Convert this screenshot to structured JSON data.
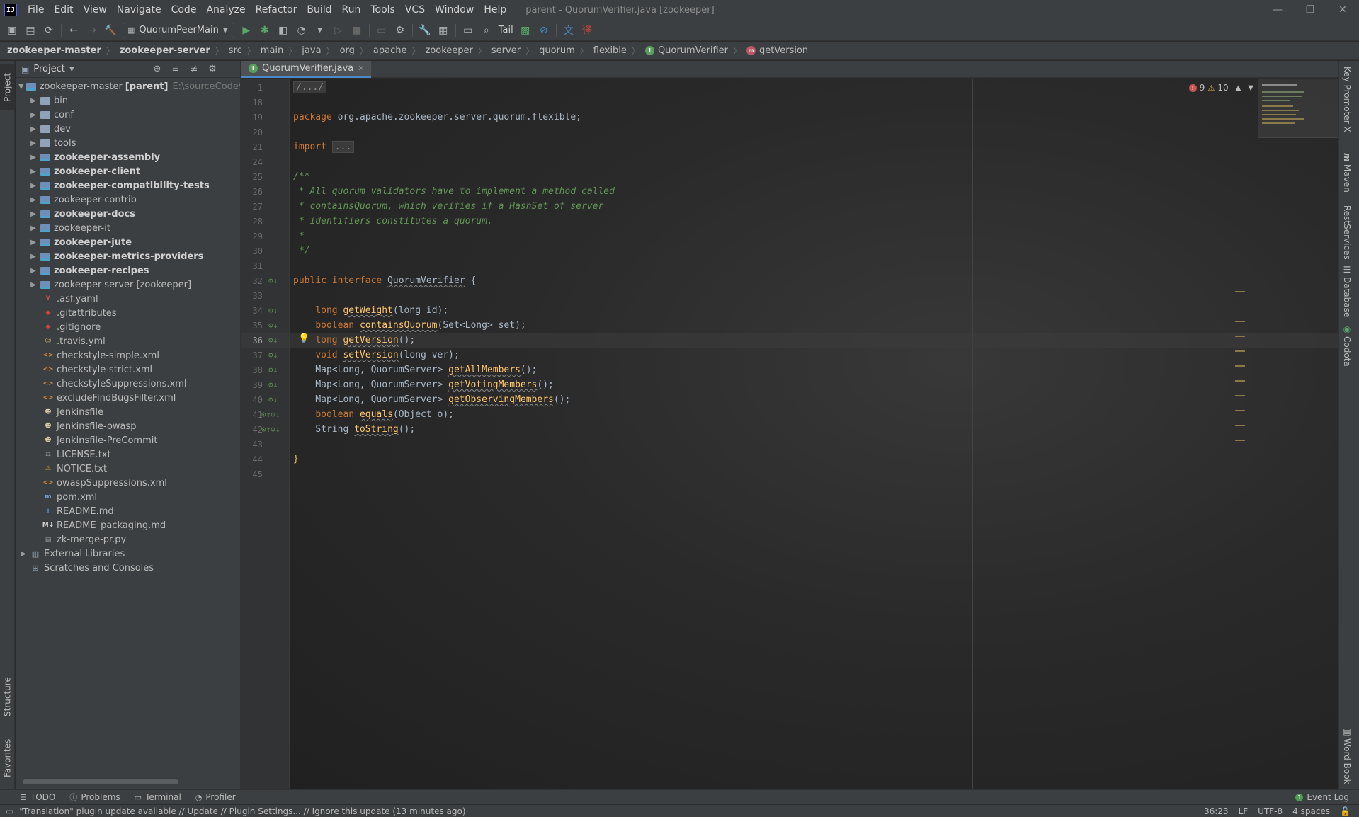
{
  "menu": {
    "items": [
      "File",
      "Edit",
      "View",
      "Navigate",
      "Code",
      "Analyze",
      "Refactor",
      "Build",
      "Run",
      "Tools",
      "VCS",
      "Window",
      "Help"
    ],
    "window_title": "parent - QuorumVerifier.java [zookeeper]"
  },
  "toolbar": {
    "run_config": "QuorumPeerMain",
    "tail_label": "Tail"
  },
  "breadcrumb": {
    "items": [
      "zookeeper-master",
      "zookeeper-server",
      "src",
      "main",
      "java",
      "org",
      "apache",
      "zookeeper",
      "server",
      "quorum",
      "flexible",
      "QuorumVerifier",
      "getVersion"
    ]
  },
  "side_tabs": {
    "project": "Project",
    "structure": "Structure",
    "favorites": "Favorites",
    "key_promoter": "Key Promoter X",
    "maven": "Maven",
    "rest_services": "RestServices",
    "database": "Database",
    "codota": "Codota",
    "word_book": "Word Book"
  },
  "project_panel": {
    "title": "Project",
    "root": {
      "name": "zookeeper-master",
      "suffix": "[parent]",
      "path": "E:\\sourceCode\\zo"
    },
    "items": [
      {
        "label": "bin",
        "kind": "folder",
        "bold": false
      },
      {
        "label": "conf",
        "kind": "folder",
        "bold": false
      },
      {
        "label": "dev",
        "kind": "folder",
        "bold": false
      },
      {
        "label": "tools",
        "kind": "folder",
        "bold": false
      },
      {
        "label": "zookeeper-assembly",
        "kind": "module",
        "bold": true
      },
      {
        "label": "zookeeper-client",
        "kind": "module",
        "bold": true
      },
      {
        "label": "zookeeper-compatibility-tests",
        "kind": "module",
        "bold": true
      },
      {
        "label": "zookeeper-contrib",
        "kind": "module",
        "bold": false
      },
      {
        "label": "zookeeper-docs",
        "kind": "module",
        "bold": true
      },
      {
        "label": "zookeeper-it",
        "kind": "module",
        "bold": false
      },
      {
        "label": "zookeeper-jute",
        "kind": "module",
        "bold": true
      },
      {
        "label": "zookeeper-metrics-providers",
        "kind": "module",
        "bold": true
      },
      {
        "label": "zookeeper-recipes",
        "kind": "module",
        "bold": true
      },
      {
        "label": "zookeeper-server [zookeeper]",
        "kind": "module",
        "bold": false
      }
    ],
    "files": [
      {
        "label": ".asf.yaml",
        "icon": "yaml-icon",
        "color": "#c75450",
        "glyph": "Y"
      },
      {
        "label": ".gitattributes",
        "icon": "git-icon",
        "color": "#d0463a",
        "glyph": "◆"
      },
      {
        "label": ".gitignore",
        "icon": "git-icon",
        "color": "#d0463a",
        "glyph": "◆"
      },
      {
        "label": ".travis.yml",
        "icon": "travis-icon",
        "color": "#c9a86a",
        "glyph": "☺"
      },
      {
        "label": "checkstyle-simple.xml",
        "icon": "xml-icon",
        "color": "#d08a3a",
        "glyph": "<>"
      },
      {
        "label": "checkstyle-strict.xml",
        "icon": "xml-icon",
        "color": "#d08a3a",
        "glyph": "<>"
      },
      {
        "label": "checkstyleSuppressions.xml",
        "icon": "xml-icon",
        "color": "#d08a3a",
        "glyph": "<>"
      },
      {
        "label": "excludeFindBugsFilter.xml",
        "icon": "xml-icon",
        "color": "#d08a3a",
        "glyph": "<>"
      },
      {
        "label": "Jenkinsfile",
        "icon": "jenkins-icon",
        "color": "#d8c9a8",
        "glyph": "☻"
      },
      {
        "label": "Jenkinsfile-owasp",
        "icon": "jenkins-icon",
        "color": "#d8c9a8",
        "glyph": "☻"
      },
      {
        "label": "Jenkinsfile-PreCommit",
        "icon": "jenkins-icon",
        "color": "#d8c9a8",
        "glyph": "☻"
      },
      {
        "label": "LICENSE.txt",
        "icon": "license-icon",
        "color": "#a0a0a0",
        "glyph": "⚖"
      },
      {
        "label": "NOTICE.txt",
        "icon": "warning-icon",
        "color": "#e0a030",
        "glyph": "⚠"
      },
      {
        "label": "owaspSuppressions.xml",
        "icon": "xml-icon",
        "color": "#d08a3a",
        "glyph": "<>"
      },
      {
        "label": "pom.xml",
        "icon": "maven-icon",
        "color": "#7aa0d8",
        "glyph": "m"
      },
      {
        "label": "README.md",
        "icon": "info-icon",
        "color": "#4a88c7",
        "glyph": "i"
      },
      {
        "label": "README_packaging.md",
        "icon": "markdown-icon",
        "color": "#d0d0d0",
        "glyph": "M↓"
      },
      {
        "label": "zk-merge-pr.py",
        "icon": "file-icon",
        "color": "#a0a0a0",
        "glyph": "▤"
      }
    ],
    "external_libraries": "External Libraries",
    "scratches": "Scratches and Consoles"
  },
  "editor": {
    "tab_label": "QuorumVerifier.java",
    "errors": "9",
    "warnings": "10",
    "lines": {
      "l1": "1",
      "l18": "18",
      "l19": "19",
      "l20": "20",
      "l21": "21",
      "l24": "24",
      "l25": "25",
      "l26": "26",
      "l27": "27",
      "l28": "28",
      "l29": "29",
      "l30": "30",
      "l31": "31",
      "l32": "32",
      "l33": "33",
      "l34": "34",
      "l35": "35",
      "l36": "36",
      "l37": "37",
      "l38": "38",
      "l39": "39",
      "l40": "40",
      "l41": "41",
      "l42": "42",
      "l43": "43",
      "l44": "44",
      "l45": "45"
    },
    "code": {
      "fold_header": "/.../",
      "package_kw": "package",
      "package_name": " org.apache.zookeeper.server.quorum.flexible;",
      "import_kw": "import",
      "import_fold": "...",
      "doc_open": "/**",
      "doc_1": " * All quorum validators have to implement a method called",
      "doc_2": " * containsQuorum, which verifies if a HashSet of server",
      "doc_3": " * identifiers constitutes a quorum.",
      "doc_4": " *",
      "doc_close": " */",
      "public_kw": "public",
      "interface_kw": "interface",
      "iface_name": "QuorumVerifier",
      "brace_open": " {",
      "m1_type": "long",
      "m1_name": "getWeight",
      "m1_args": "(long id);",
      "m2_type": "boolean",
      "m2_name": "containsQuorum",
      "m2_args": "(Set<Long> set);",
      "m3_type": "long",
      "m3_name": "getVersion",
      "m3_args": "();",
      "m4_type": "void",
      "m4_name": "setVersion",
      "m4_args": "(long ver);",
      "m5_type": "Map<Long, QuorumServer> ",
      "m5_name": "getAllMembers",
      "m5_args": "();",
      "m6_type": "Map<Long, QuorumServer> ",
      "m6_name": "getVotingMembers",
      "m6_args": "();",
      "m7_type": "Map<Long, QuorumServer> ",
      "m7_name": "getObservingMembers",
      "m7_args": "();",
      "m8_type": "boolean",
      "m8_name": "equals",
      "m8_args": "(Object o);",
      "m9_type": "String ",
      "m9_name": "toString",
      "m9_args": "();",
      "brace_close": "}"
    }
  },
  "bottom_tools": {
    "todo": "TODO",
    "problems": "Problems",
    "terminal": "Terminal",
    "profiler": "Profiler",
    "event_log": "Event Log"
  },
  "status": {
    "message": "\"Translation\" plugin update available // Update // Plugin Settings... // Ignore this update (13 minutes ago)",
    "position": "36:23",
    "line_sep": "LF",
    "encoding": "UTF-8",
    "indent": "4 spaces"
  }
}
